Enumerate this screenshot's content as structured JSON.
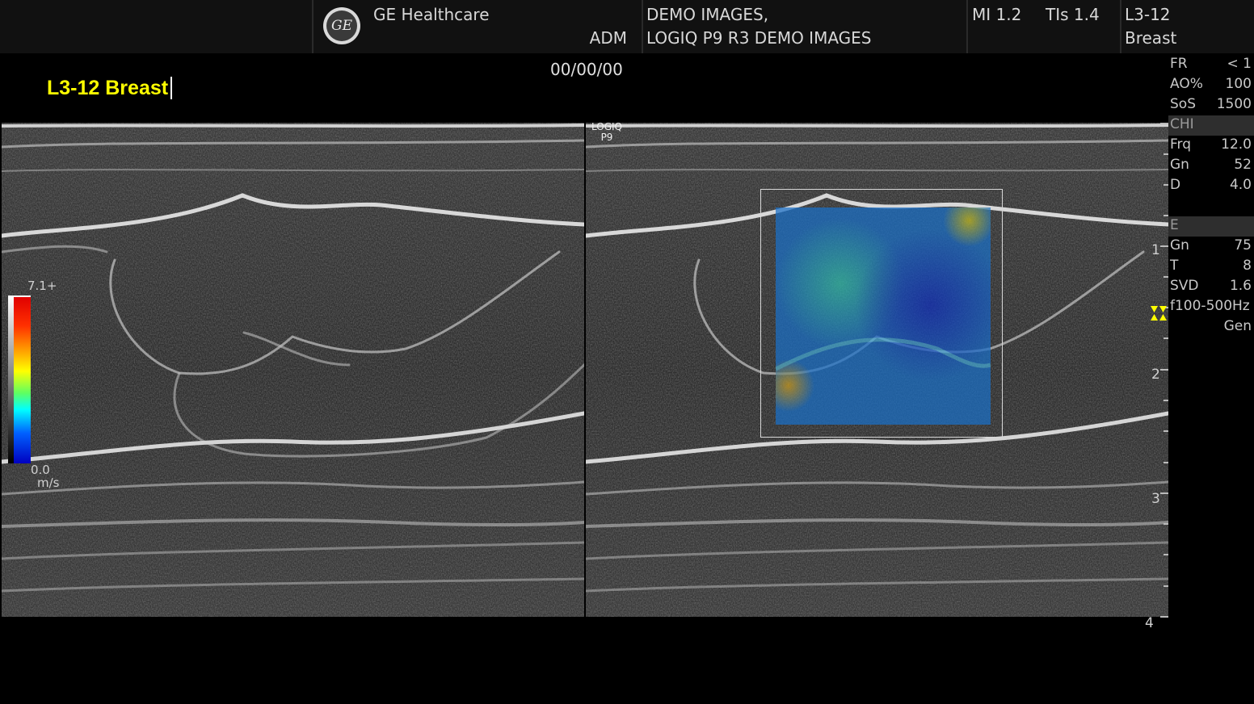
{
  "header": {
    "manufacturer": "GE Healthcare",
    "logo_text": "GE",
    "operator": "ADM",
    "patient_line1": "DEMO IMAGES,",
    "patient_line2": "LOGIQ P9 R3 DEMO IMAGES",
    "mi": "MI 1.2",
    "tis": "TIs 1.4",
    "probe": "L3-12",
    "preset": "Breast"
  },
  "annotation": {
    "probe_preset": "L3-12 Breast"
  },
  "date": "00/00/00",
  "watermark": {
    "line1": "LOGIQ",
    "line2": "P9"
  },
  "color_scale": {
    "max_label": "7.1+",
    "min_label": "0.0",
    "unit": "m/s",
    "colors": [
      "#e00000",
      "#ffb000",
      "#ffff00",
      "#00ffff",
      "#0060ff",
      "#0000c0"
    ]
  },
  "depth_scale": {
    "labels": [
      "1",
      "2",
      "3",
      "4"
    ]
  },
  "params": {
    "general": [
      {
        "key": "FR",
        "value": "< 1"
      },
      {
        "key": "AO%",
        "value": "100"
      },
      {
        "key": "SoS",
        "value": "1500"
      }
    ],
    "chi_title": "CHI",
    "chi": [
      {
        "key": "Frq",
        "value": "12.0"
      },
      {
        "key": "Gn",
        "value": "52"
      },
      {
        "key": "D",
        "value": "4.0"
      }
    ],
    "e_title": "E",
    "e": [
      {
        "key": "Gn",
        "value": "75"
      },
      {
        "key": "T",
        "value": "8"
      },
      {
        "key": "SVD",
        "value": "1.6"
      },
      {
        "key": "f100-500Hz",
        "value": ""
      },
      {
        "key": "",
        "value": "Gen"
      }
    ]
  }
}
